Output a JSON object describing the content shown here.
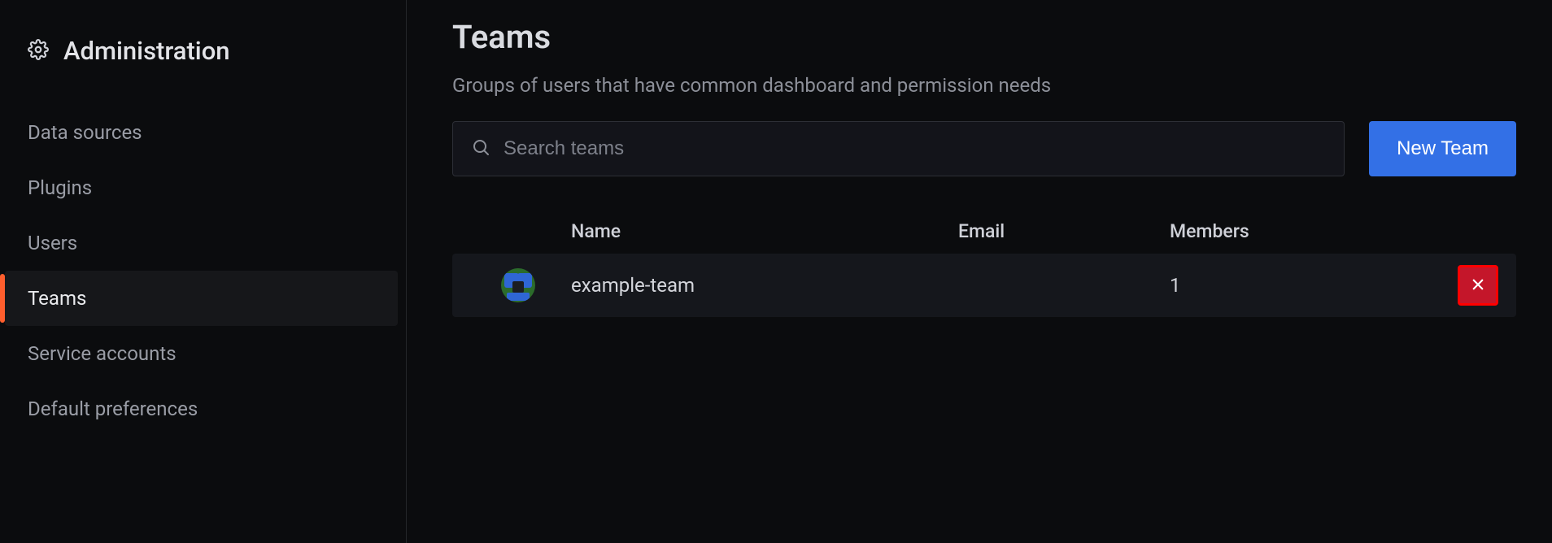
{
  "sidebar": {
    "title": "Administration",
    "items": [
      {
        "label": "Data sources",
        "active": false
      },
      {
        "label": "Plugins",
        "active": false
      },
      {
        "label": "Users",
        "active": false
      },
      {
        "label": "Teams",
        "active": true
      },
      {
        "label": "Service accounts",
        "active": false
      },
      {
        "label": "Default preferences",
        "active": false
      }
    ]
  },
  "page": {
    "title": "Teams",
    "subtitle": "Groups of users that have common dashboard and permission needs"
  },
  "search": {
    "placeholder": "Search teams",
    "value": ""
  },
  "buttons": {
    "new_team": "New Team"
  },
  "table": {
    "columns": {
      "name": "Name",
      "email": "Email",
      "members": "Members"
    },
    "rows": [
      {
        "name": "example-team",
        "email": "",
        "members": "1"
      }
    ]
  }
}
